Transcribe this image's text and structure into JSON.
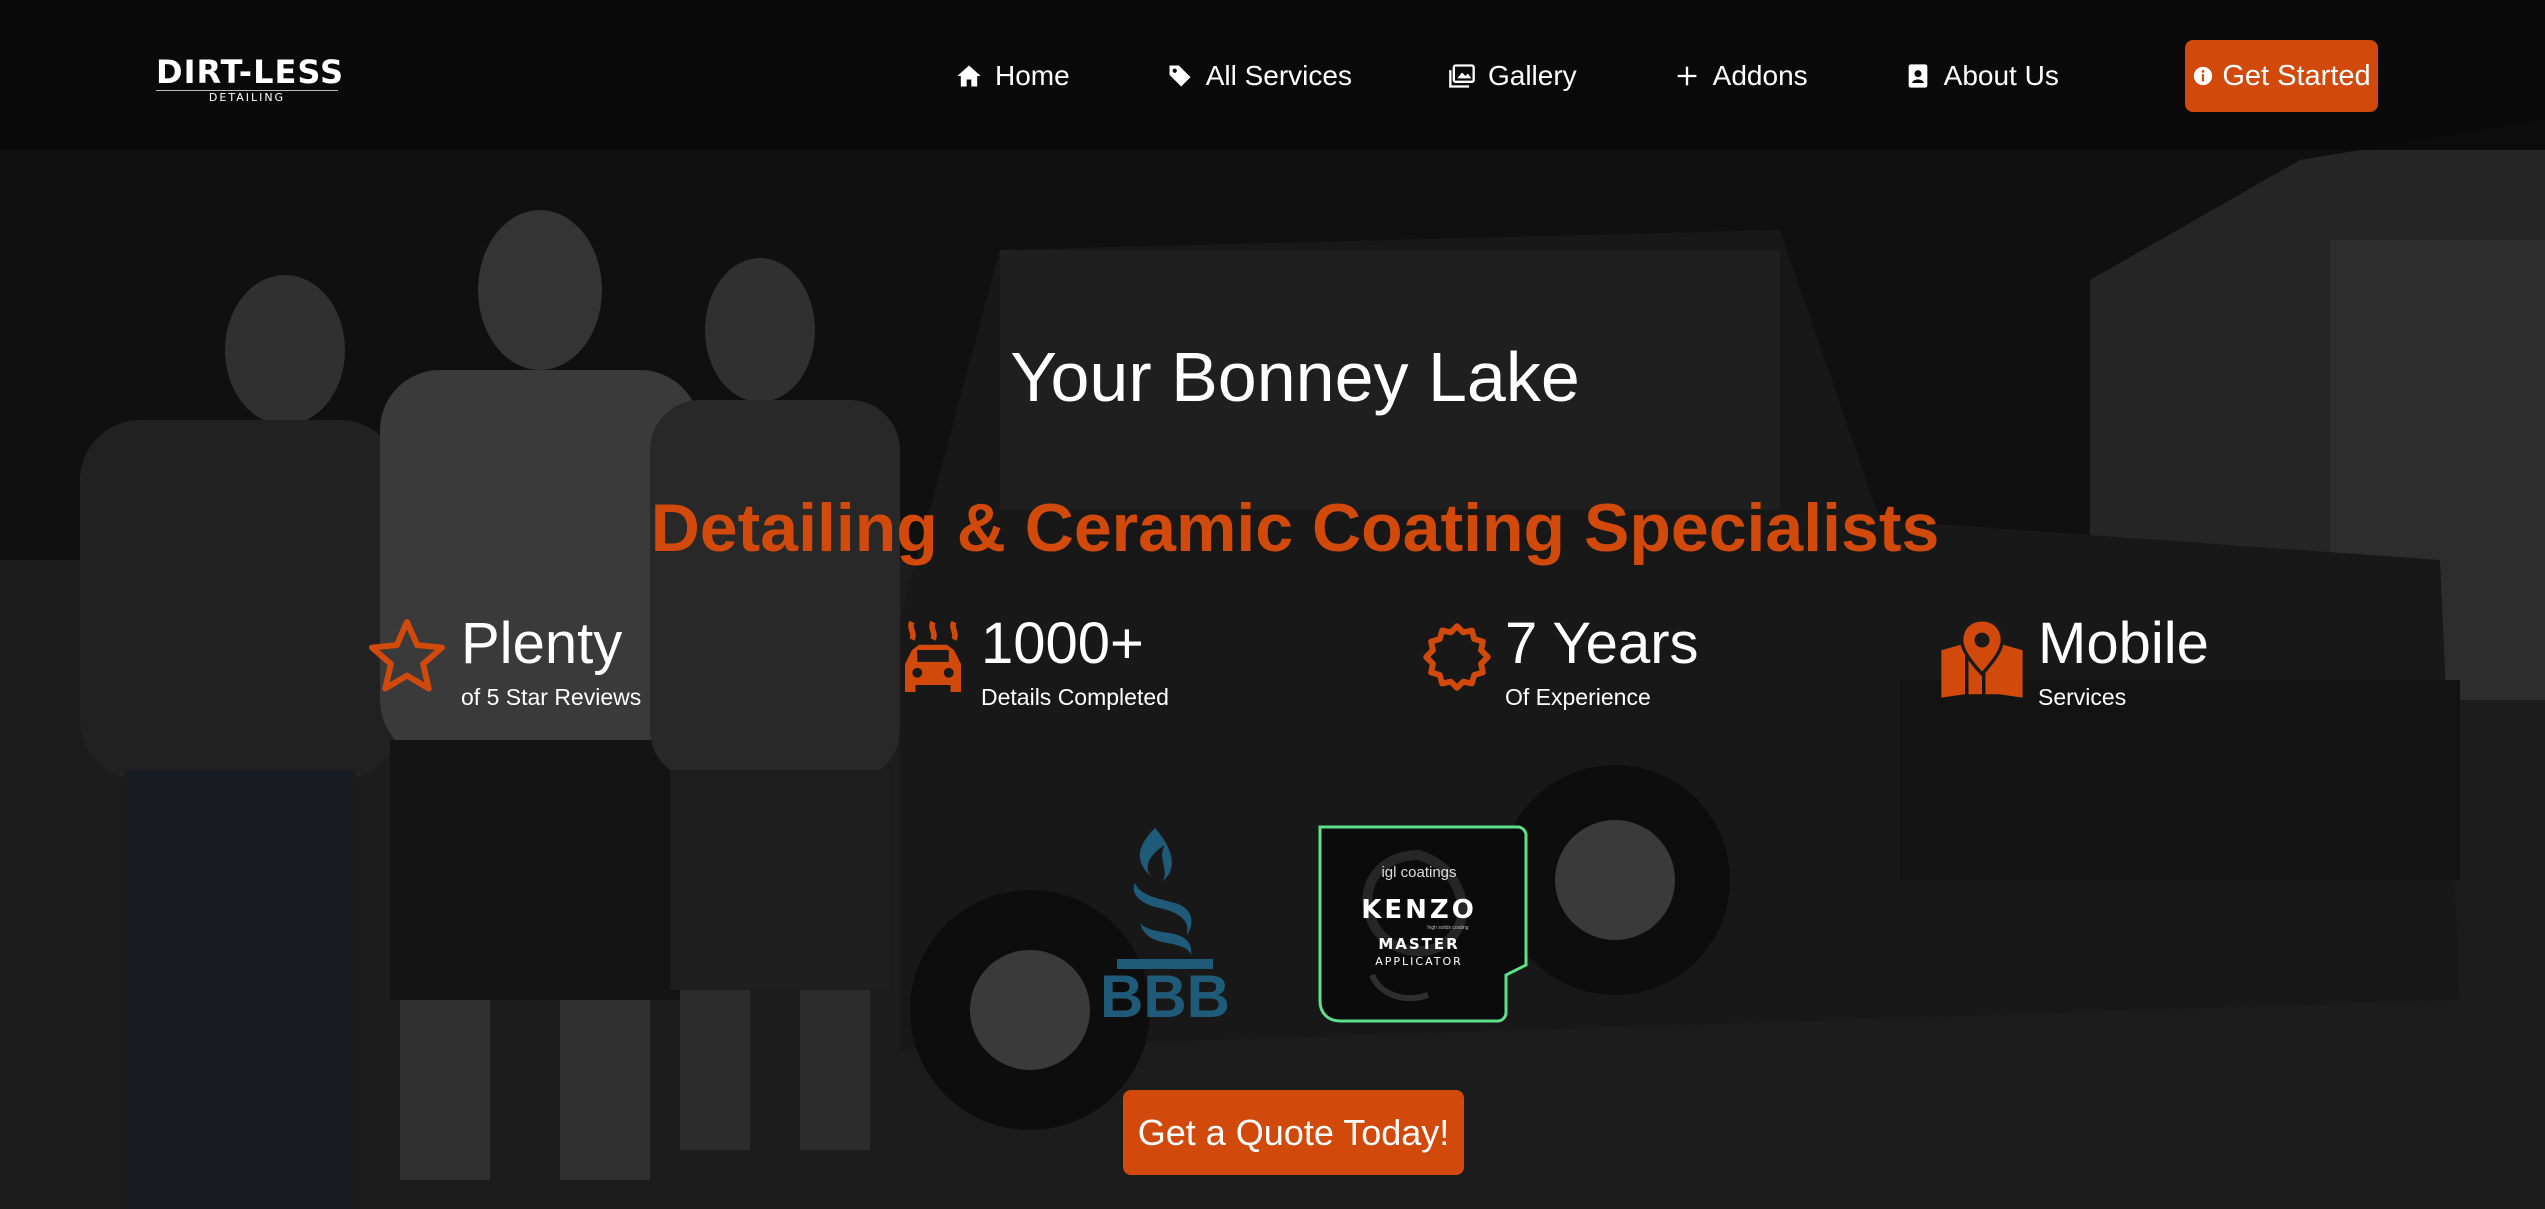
{
  "header": {
    "logo_text": "DIRT-LESS",
    "logo_subtext": "DETAILING",
    "nav": [
      {
        "label": "Home",
        "icon": "home-icon"
      },
      {
        "label": "All Services",
        "icon": "tag-icon"
      },
      {
        "label": "Gallery",
        "icon": "images-icon"
      },
      {
        "label": "Addons",
        "icon": "plus-icon"
      },
      {
        "label": "About Us",
        "icon": "id-badge-icon"
      }
    ],
    "cta_label": "Get Started",
    "cta_icon": "info-circle-icon"
  },
  "hero": {
    "title": "Your Bonney Lake",
    "subtitle": "Detailing & Ceramic Coating Specialists",
    "stats": [
      {
        "value": "Plenty",
        "label": "of 5 Star Reviews",
        "icon": "star-outline-icon"
      },
      {
        "value": "1000+",
        "label": "Details Completed",
        "icon": "car-wash-icon"
      },
      {
        "value": "7 Years",
        "label": "Of Experience",
        "icon": "certificate-icon"
      },
      {
        "value": "Mobile",
        "label": "Services",
        "icon": "map-marker-icon"
      }
    ],
    "badges": {
      "bbb_text": "BBB",
      "igl_brand": "igl coatings",
      "igl_product": "KENZO",
      "igl_tagline": "high solids coating",
      "igl_line1": "MASTER",
      "igl_line2": "APPLICATOR"
    },
    "cta_label": "Get a Quote Today!"
  },
  "colors": {
    "accent": "#d14a0c",
    "header_bg": "#0a0a0a",
    "text": "#ffffff",
    "bbb_blue": "#1f5a78",
    "igl_green": "#5ee08a"
  }
}
